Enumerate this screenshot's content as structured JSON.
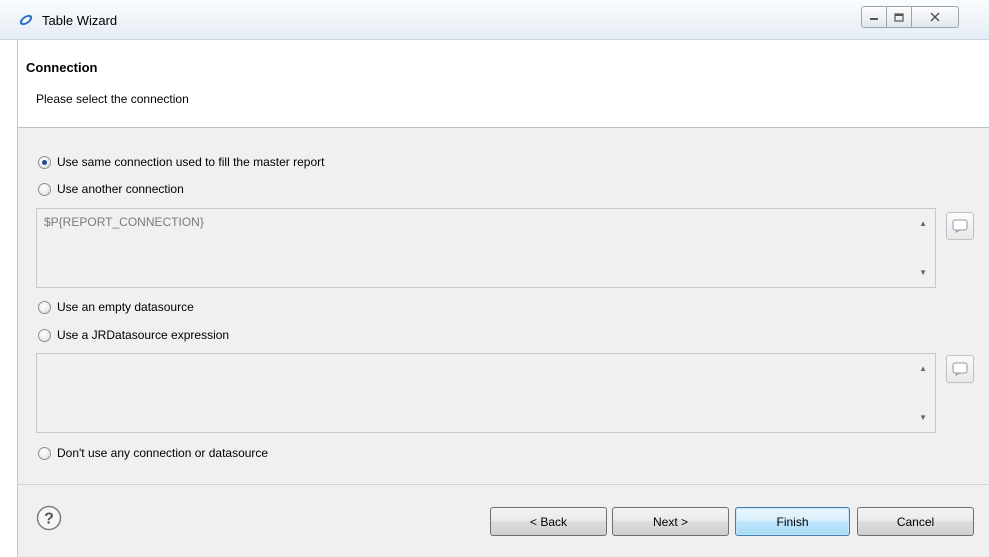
{
  "window": {
    "title": "Table Wizard"
  },
  "header": {
    "title": "Connection",
    "description": "Please select the connection"
  },
  "options": [
    {
      "label": "Use same connection used to fill the master report",
      "checked": true
    },
    {
      "label": "Use another connection",
      "checked": false
    },
    {
      "label": "Use an empty datasource",
      "checked": false
    },
    {
      "label": "Use a JRDatasource expression",
      "checked": false
    },
    {
      "label": "Don't use any connection or datasource",
      "checked": false
    }
  ],
  "connection_expression": {
    "value": "$P{REPORT_CONNECTION}"
  },
  "datasource_expression": {
    "value": ""
  },
  "buttons": {
    "back": "< Back",
    "next": "Next >",
    "finish": "Finish",
    "cancel": "Cancel"
  },
  "icons": {
    "app": "eclipse-logo-icon",
    "help": "help-icon",
    "expression_editor": "expression-editor-icon"
  }
}
